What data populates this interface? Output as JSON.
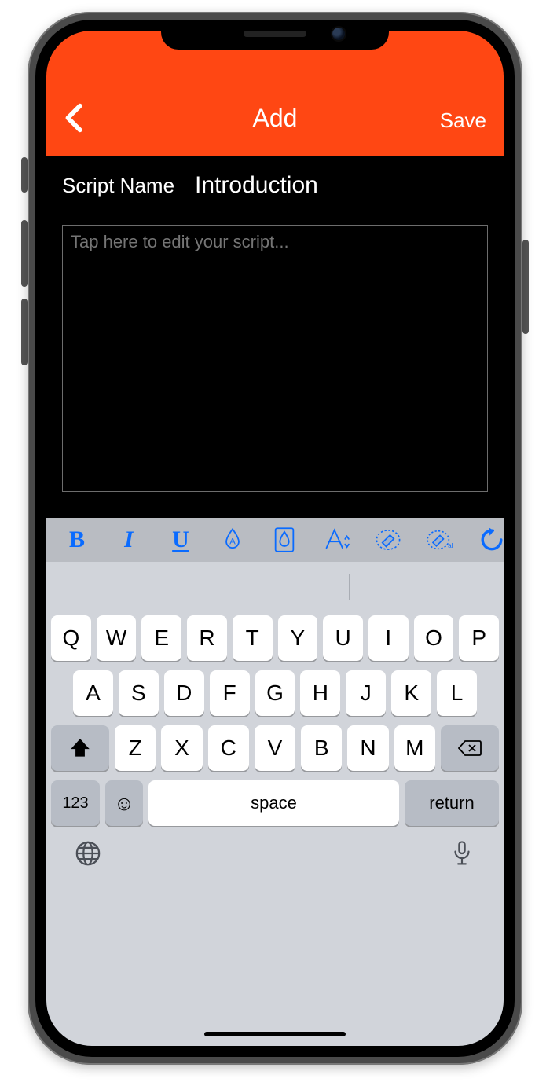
{
  "colors": {
    "accent": "#ff4713",
    "toolbar_icon": "#0a6bff"
  },
  "header": {
    "title": "Add",
    "save_label": "Save"
  },
  "form": {
    "name_label": "Script Name",
    "name_value": "Introduction",
    "script_placeholder": "Tap here to edit your script...",
    "script_value": ""
  },
  "format_toolbar": {
    "bold": "B",
    "italic": "I",
    "underline": "U"
  },
  "keyboard": {
    "row1": [
      "Q",
      "W",
      "E",
      "R",
      "T",
      "Y",
      "U",
      "I",
      "O",
      "P"
    ],
    "row2": [
      "A",
      "S",
      "D",
      "F",
      "G",
      "H",
      "J",
      "K",
      "L"
    ],
    "row3": [
      "Z",
      "X",
      "C",
      "V",
      "B",
      "N",
      "M"
    ],
    "numeric_label": "123",
    "space_label": "space",
    "return_label": "return"
  }
}
